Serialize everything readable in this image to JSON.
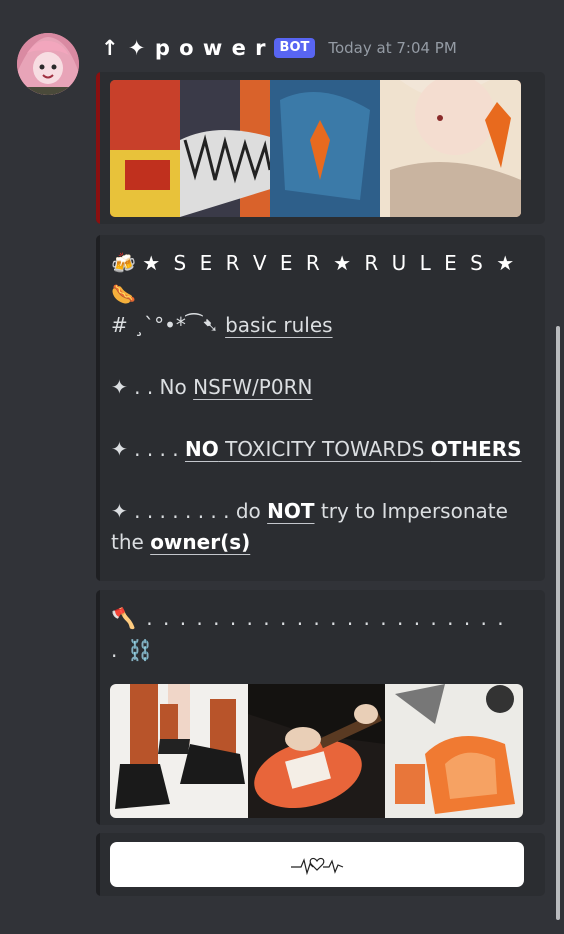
{
  "message": {
    "username": "↑ ✦ p o w e r",
    "bot_badge": "BOT",
    "timestamp": "Today at 7:04 PM"
  },
  "rules_embed": {
    "title_prefix": "🍻",
    "title": "★ S E R V E R ★ R U L E S ★",
    "title_suffix": "🌭",
    "section_prefix": "# ¸`°•*⁀➷",
    "section_label": "basic rules",
    "rule1_prefix": "✦ . .  No ",
    "rule1_text": "NSFW/P0RN",
    "rule2_prefix": "✦ . . . . ",
    "rule2_bold": "NO",
    "rule2_text": " TOXICITY TOWARDS ",
    "rule2_bold2": "OTHERS",
    "rule3_prefix": "✦ . . . . . . . .  do ",
    "rule3_bold": "NOT",
    "rule3_mid": " try to Impersonate the ",
    "rule3_bold2": "owner(s)"
  },
  "divider_embed": {
    "text": "🪓 . . . . . . . . . . .   . . . . . . . . . . . . ⛓️"
  },
  "colors": {
    "background": "#313338",
    "embed_bg": "#2b2d31",
    "accent_red": "#8a1010",
    "bot_badge": "#5865f2"
  },
  "icons": {
    "avatar": "avatar-pink-hair-character",
    "button_icon": "heartbeat-heart-icon"
  }
}
